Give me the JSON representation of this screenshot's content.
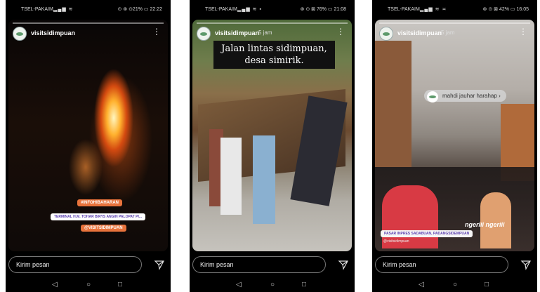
{
  "status_bars": [
    {
      "carrier": "TSEL-PAKAIM...",
      "signal": "▂▄▆ ≋",
      "right": "⊙ ⊛ ⊙21% ▭ 22:22"
    },
    {
      "carrier": "TSEL-PAKAIM",
      "signal": "▂▄▆ ≋ ▪",
      "right": "⊛ ⊙ ⊠ 76% ▭ 21:08"
    },
    {
      "carrier": "TSEL-PAKAIM",
      "signal": "▂▄▆ ≋ ≍",
      "right": "⊛ ⊙ ⊠ 42% ▭ 16:05"
    }
  ],
  "stories": [
    {
      "username": "visitsidimpuan",
      "time": "",
      "stickers": [
        "#INFOHIBAHARAN",
        "TERMINAL H.M. TOHAR BIRYS ANGIN PALOPAT PI...",
        "@VISITSIDIMPUAN"
      ]
    },
    {
      "username": "visitsidimpuan",
      "time": "5 jam",
      "caption": "Jalan lintas sidimpuan, desa simirik."
    },
    {
      "username": "visitsidimpuan",
      "time": "5 jam",
      "mention": "mahdi jauhar harahap",
      "location": "PASAR INPRES SADABUAN, PADANGSIDEMPUAN",
      "location_sub": "@visitsidimpuan",
      "overlay_text": "ngeriii ngeriii"
    }
  ],
  "message_placeholder": "Kirim pesan",
  "icons": {
    "more": "more-vertical-icon",
    "send": "send-icon",
    "back": "back-icon",
    "home": "home-icon",
    "recent": "recent-apps-icon"
  },
  "nav_glyphs": {
    "back": "◁",
    "home": "○",
    "recent": "□"
  },
  "glyphs": {
    "more": "⋮",
    "chevron": "›"
  },
  "colors": {
    "sticker_orange": "#e8733c",
    "sticker_purple": "#9b59d6",
    "location_bg": "#f5f5f5"
  }
}
